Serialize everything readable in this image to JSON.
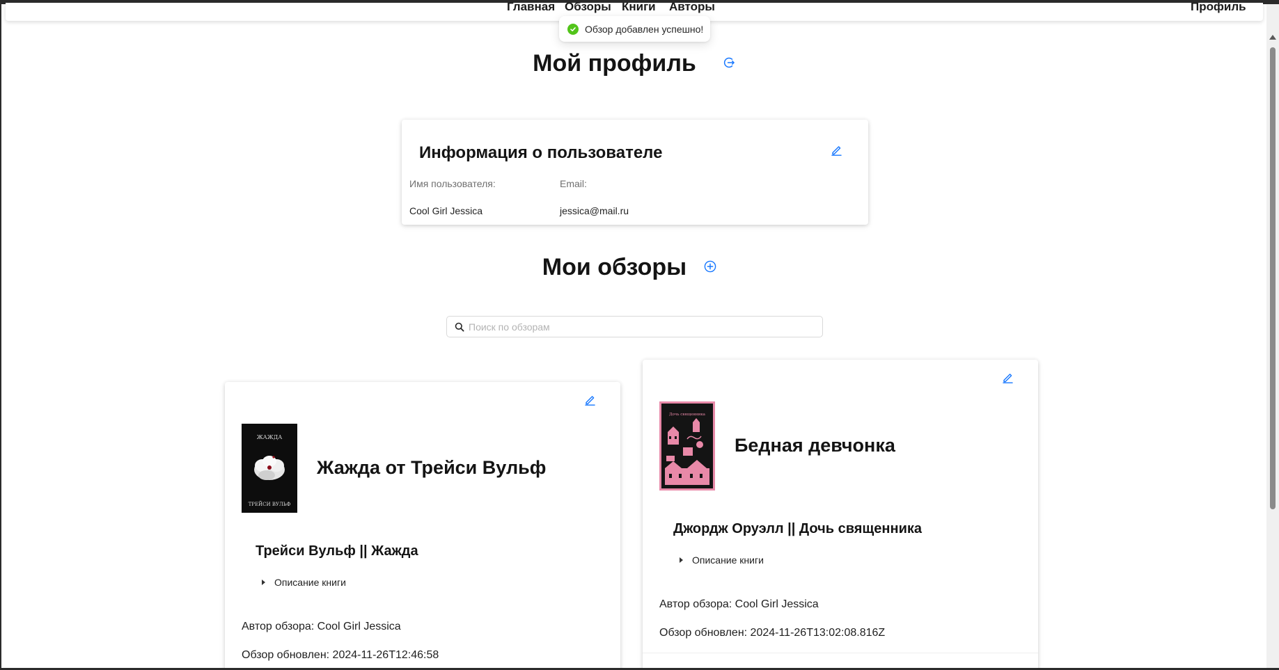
{
  "nav": {
    "items": [
      "Главная",
      "Обзоры",
      "Книги",
      "Авторы"
    ],
    "profile": "Профиль"
  },
  "toast": {
    "message": "Обзор добавлен успешно!",
    "status_color": "#52c41a"
  },
  "profile": {
    "title": "Мой профиль",
    "refresh_icon": "logout-icon",
    "info": {
      "title": "Информация о пользователе",
      "username_label": "Имя пользователя:",
      "username": "Cool Girl Jessica",
      "email_label": "Email:",
      "email": "jessica@mail.ru"
    }
  },
  "reviews": {
    "title": "Мои обзоры",
    "add_icon": "plus-circle-icon",
    "search_placeholder": "Поиск по обзорам",
    "items": [
      {
        "heading": "Жажда от Трейси Вульф",
        "book": "Трейси Вульф || Жажда",
        "description_label": "Описание книги",
        "author_line": "Автор обзора: Cool Girl Jessica",
        "updated_line": "Обзор обновлен: 2024-11-26T12:46:58",
        "cover": {
          "top_text": "ЖАЖДА",
          "bottom_text": "ТРЕЙСИ ВУЛЬФ"
        }
      },
      {
        "heading": "Бедная девчонка",
        "book": "Джордж Оруэлл || Дочь священника",
        "description_label": "Описание книги",
        "author_line": "Автор обзора: Cool Girl Jessica",
        "updated_line": "Обзор обновлен: 2024-11-26T13:02:08.816Z",
        "cover": {
          "top_text": "Дочь священника"
        }
      }
    ]
  },
  "colors": {
    "accent": "#1677ff",
    "success": "#52c41a",
    "cover2_pink": "#e889a8"
  }
}
